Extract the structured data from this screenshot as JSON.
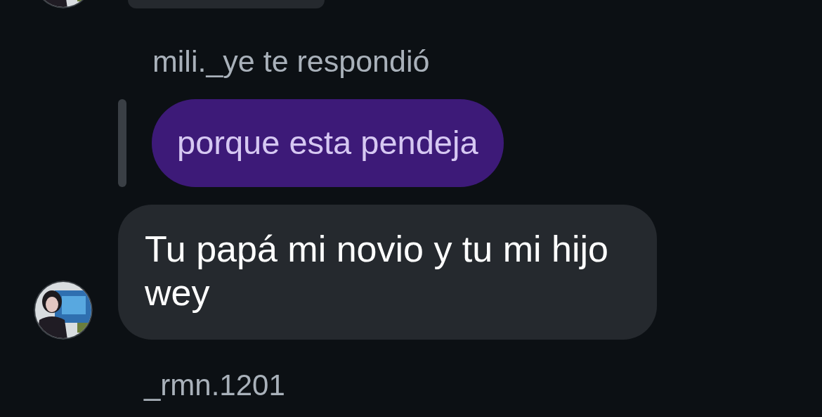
{
  "reply": {
    "label": "mili._ye te respondió",
    "quoted": "porque esta pendeja"
  },
  "message": {
    "text": "Tu papá mi novio y tu mi hijo wey"
  },
  "next_sender": "_rmn.1201"
}
